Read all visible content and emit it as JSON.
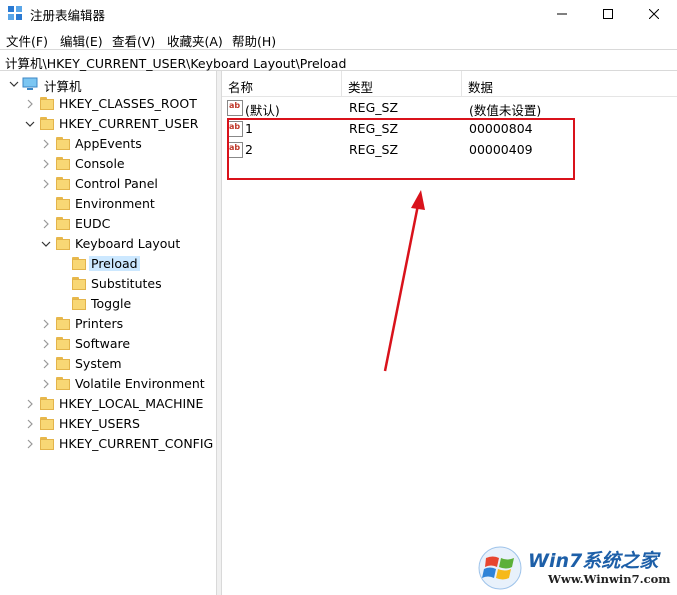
{
  "window": {
    "title": "注册表编辑器"
  },
  "menu": [
    "文件(F)",
    "编辑(E)",
    "查看(V)",
    "收藏夹(A)",
    "帮助(H)"
  ],
  "address": "计算机\\HKEY_CURRENT_USER\\Keyboard Layout\\Preload",
  "tree": [
    {
      "label": "计算机",
      "depth": 0,
      "expanded": true,
      "icon": "computer-icon"
    },
    {
      "label": "HKEY_CLASSES_ROOT",
      "depth": 1,
      "expanded": false,
      "icon": "folder-icon"
    },
    {
      "label": "HKEY_CURRENT_USER",
      "depth": 1,
      "expanded": true,
      "icon": "folder-icon"
    },
    {
      "label": "AppEvents",
      "depth": 2,
      "expanded": false,
      "icon": "folder-icon"
    },
    {
      "label": "Console",
      "depth": 2,
      "expanded": false,
      "icon": "folder-icon"
    },
    {
      "label": "Control Panel",
      "depth": 2,
      "expanded": false,
      "icon": "folder-icon"
    },
    {
      "label": "Environment",
      "depth": 2,
      "expanded": null,
      "icon": "folder-icon"
    },
    {
      "label": "EUDC",
      "depth": 2,
      "expanded": false,
      "icon": "folder-icon"
    },
    {
      "label": "Keyboard Layout",
      "depth": 2,
      "expanded": true,
      "icon": "folder-icon"
    },
    {
      "label": "Preload",
      "depth": 3,
      "expanded": null,
      "icon": "folder-icon",
      "selected": true
    },
    {
      "label": "Substitutes",
      "depth": 3,
      "expanded": null,
      "icon": "folder-icon"
    },
    {
      "label": "Toggle",
      "depth": 3,
      "expanded": null,
      "icon": "folder-icon"
    },
    {
      "label": "Printers",
      "depth": 2,
      "expanded": false,
      "icon": "folder-icon"
    },
    {
      "label": "Software",
      "depth": 2,
      "expanded": false,
      "icon": "folder-icon"
    },
    {
      "label": "System",
      "depth": 2,
      "expanded": false,
      "icon": "folder-icon"
    },
    {
      "label": "Volatile Environment",
      "depth": 2,
      "expanded": false,
      "icon": "folder-icon"
    },
    {
      "label": "HKEY_LOCAL_MACHINE",
      "depth": 1,
      "expanded": false,
      "icon": "folder-icon"
    },
    {
      "label": "HKEY_USERS",
      "depth": 1,
      "expanded": false,
      "icon": "folder-icon"
    },
    {
      "label": "HKEY_CURRENT_CONFIG",
      "depth": 1,
      "expanded": false,
      "icon": "folder-icon"
    }
  ],
  "list": {
    "columns": [
      "名称",
      "类型",
      "数据"
    ],
    "rows": [
      {
        "name": "(默认)",
        "type": "REG_SZ",
        "data": "(数值未设置)"
      },
      {
        "name": "1",
        "type": "REG_SZ",
        "data": "00000804"
      },
      {
        "name": "2",
        "type": "REG_SZ",
        "data": "00000409"
      }
    ]
  },
  "icons": {
    "value_icon_text": "ab"
  },
  "watermark": {
    "brand": "Win7系统之家",
    "url": "Www.Winwin7.com"
  },
  "colors": {
    "annotation": "#d9121b",
    "selection": "#cce8ff",
    "folder": "#f8d775"
  }
}
